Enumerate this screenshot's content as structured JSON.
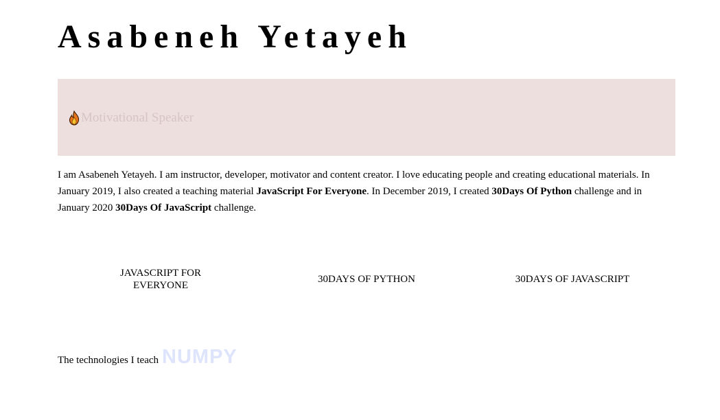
{
  "header": {
    "title": "Asabeneh Yetayeh"
  },
  "banner": {
    "icon": "fire-icon",
    "role": "Motivational Speaker",
    "background": "#eddfde",
    "role_color": "#d5c6c5"
  },
  "bio": {
    "part1": "I am Asabeneh Yetayeh. I am instructor, developer, motivator and content creator. I love educating people and creating educational materials. In January 2019, I also created a teaching material ",
    "highlight1": "JavaScript For Everyone",
    "part2": ". In December 2019, I created ",
    "highlight2": "30Days Of Python",
    "part3": " challenge and in January 2020 ",
    "highlight3": "30Days Of JavaScript",
    "part4": " challenge."
  },
  "challenges": [
    {
      "label": "JavaScript For Everyone"
    },
    {
      "label": "30Days Of Python"
    },
    {
      "label": "30Days Of JavaScript"
    }
  ],
  "technologies": {
    "label": "The technologies I teach",
    "current": "NUMPY",
    "current_color": "#dde4fb"
  }
}
